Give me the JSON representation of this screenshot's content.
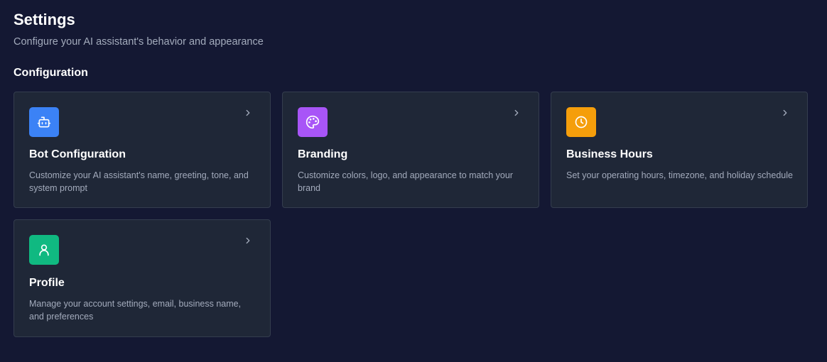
{
  "header": {
    "title": "Settings",
    "subtitle": "Configure your AI assistant's behavior and appearance"
  },
  "section": {
    "title": "Configuration"
  },
  "cards": [
    {
      "title": "Bot Configuration",
      "description": "Customize your AI assistant's name, greeting, tone, and system prompt",
      "icon": "bot-icon",
      "color": "#3b82f6"
    },
    {
      "title": "Branding",
      "description": "Customize colors, logo, and appearance to match your brand",
      "icon": "palette-icon",
      "color": "#a855f7"
    },
    {
      "title": "Business Hours",
      "description": "Set your operating hours, timezone, and holiday schedule",
      "icon": "clock-icon",
      "color": "#f59e0b"
    },
    {
      "title": "Profile",
      "description": "Manage your account settings, email, business name, and preferences",
      "icon": "user-icon",
      "color": "#10b981"
    }
  ]
}
